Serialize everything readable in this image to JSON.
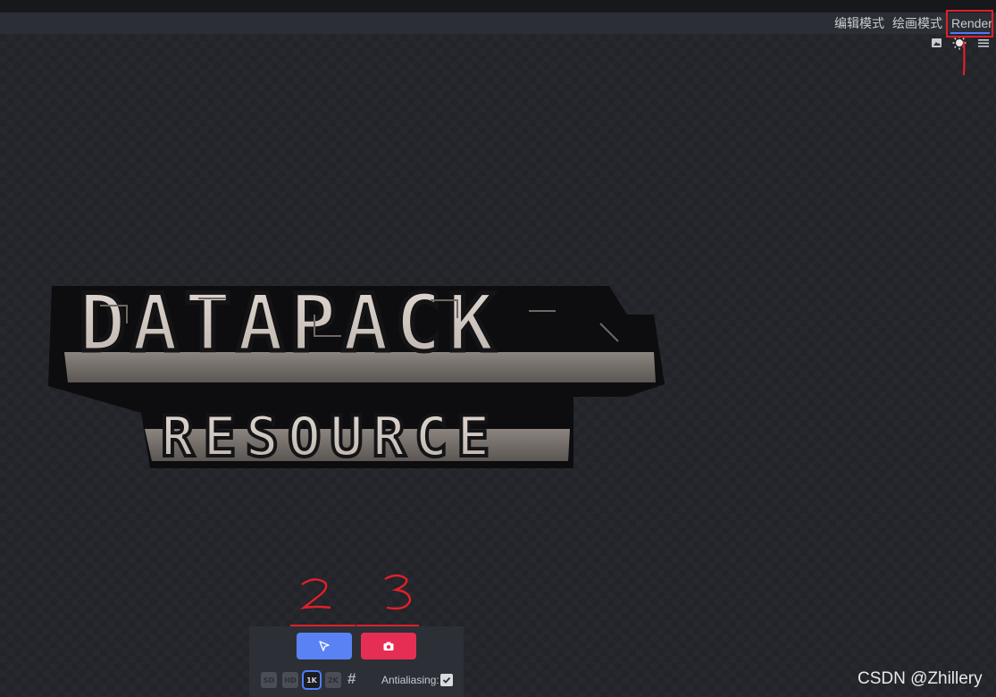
{
  "header": {
    "tabs": [
      {
        "label": "编辑模式"
      },
      {
        "label": "绘画模式"
      },
      {
        "label": "Render"
      }
    ],
    "icons": [
      "image-icon",
      "sun-icon",
      "menu-icon"
    ]
  },
  "annotations": {
    "markers": [
      "1",
      "2",
      "3"
    ]
  },
  "logo": {
    "line1": "DATAPACK",
    "line2": "RESOURCE"
  },
  "render_toolbar": {
    "resolutions": [
      {
        "label": "SD"
      },
      {
        "label": "HD"
      },
      {
        "label": "1K",
        "selected": true
      },
      {
        "label": "2K"
      }
    ],
    "custom_symbol": "#",
    "antialiasing_label": "Antialiasing:",
    "antialiasing_checked": true,
    "preview_icon": "cursor-icon",
    "screenshot_icon": "camera-icon"
  },
  "watermark": "CSDN @Zhillery",
  "colors": {
    "accent": "#4f7cff",
    "screenshot_button": "#e62e55",
    "preview_button": "#5b82f5",
    "annotation": "#e0202a"
  }
}
